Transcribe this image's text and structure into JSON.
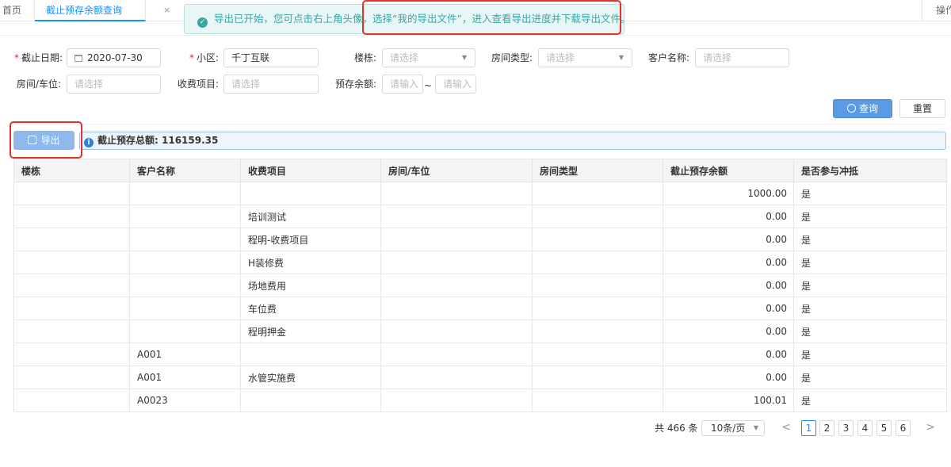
{
  "tabs": {
    "home": "首页",
    "active": "截止预存余额查询",
    "close_glyph": "×",
    "ops": "操作"
  },
  "toast": {
    "icon": "check-circle-icon",
    "text": "导出已开始，您可点击右上角头像，选择“我的导出文件”，进入查看导出进度并下载导出文件。"
  },
  "form": {
    "date_label": "截止日期:",
    "date_value": "2020-07-30",
    "community_label": "小区:",
    "community_value": "千丁互联",
    "building_label": "楼栋:",
    "building_placeholder": "请选择",
    "room_type_label": "房间类型:",
    "room_type_placeholder": "请选择",
    "customer_label": "客户名称:",
    "customer_placeholder": "请选择",
    "room_label": "房间/车位:",
    "room_placeholder": "请选择",
    "fee_label": "收费项目:",
    "fee_placeholder": "请选择",
    "balance_label": "预存余额:",
    "balance_min_placeholder": "请输入",
    "balance_max_placeholder": "请输入",
    "range_sep": "~",
    "required_mark": "*"
  },
  "buttons": {
    "query": "查询",
    "reset": "重置",
    "export": "导出"
  },
  "summary": {
    "label": "截止预存总额:",
    "value": "116159.35"
  },
  "table": {
    "columns": [
      "楼栋",
      "客户名称",
      "收费项目",
      "房间/车位",
      "房间类型",
      "截止预存余额",
      "是否参与冲抵"
    ],
    "rows": [
      [
        "",
        "",
        "",
        "",
        "",
        "1000.00",
        "是"
      ],
      [
        "",
        "",
        "培训测试",
        "",
        "",
        "0.00",
        "是"
      ],
      [
        "",
        "",
        "程明-收费项目",
        "",
        "",
        "0.00",
        "是"
      ],
      [
        "",
        "",
        "H装修费",
        "",
        "",
        "0.00",
        "是"
      ],
      [
        "",
        "",
        "场地费用",
        "",
        "",
        "0.00",
        "是"
      ],
      [
        "",
        "",
        "车位费",
        "",
        "",
        "0.00",
        "是"
      ],
      [
        "",
        "",
        "程明押金",
        "",
        "",
        "0.00",
        "是"
      ],
      [
        "",
        "A001",
        "",
        "",
        "",
        "0.00",
        "是"
      ],
      [
        "",
        "A001",
        "水管实施费",
        "",
        "",
        "0.00",
        "是"
      ],
      [
        "",
        "A0023",
        "",
        "",
        "",
        "100.01",
        "是"
      ]
    ]
  },
  "pagination": {
    "total_text": "共 466 条",
    "page_size": "10条/页",
    "prev": "<",
    "next": ">",
    "pages": [
      "1",
      "2",
      "3",
      "4",
      "5",
      "6"
    ],
    "current": "1"
  }
}
